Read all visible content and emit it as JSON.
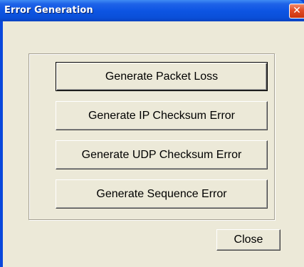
{
  "window": {
    "title": "Error Generation",
    "close_glyph": "✕",
    "title_bar_color": "#0a4fd9",
    "client_color": "#ece9d8"
  },
  "buttons": {
    "packet_loss": "Generate Packet Loss",
    "ip_checksum": "Generate IP Checksum Error",
    "udp_checksum": "Generate UDP Checksum Error",
    "sequence": "Generate Sequence Error",
    "close": "Close"
  },
  "icons": {
    "window_close": "close-icon"
  }
}
